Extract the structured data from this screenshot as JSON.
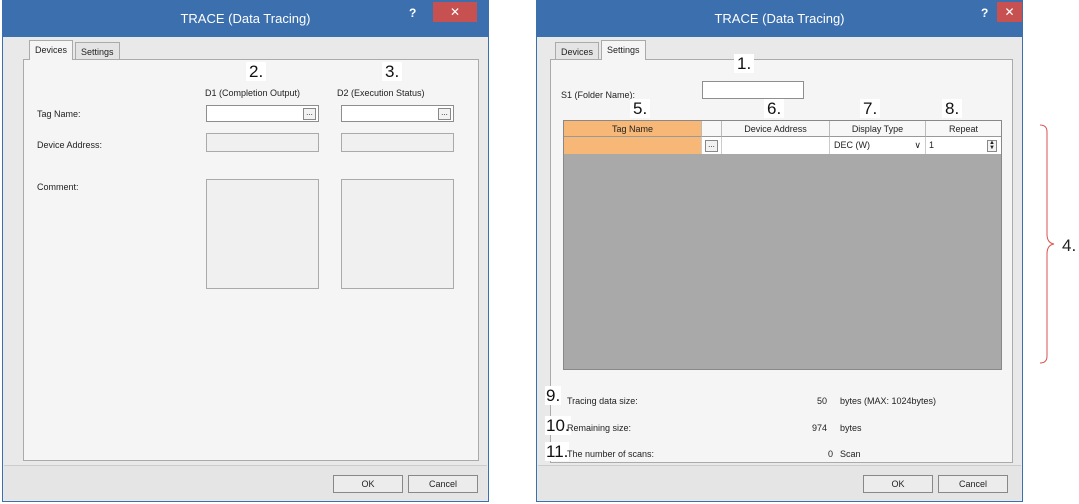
{
  "left_dialog": {
    "title": "TRACE (Data Tracing)",
    "help": "?",
    "close": "✕",
    "tabs": [
      "Devices",
      "Settings"
    ],
    "col_headers": [
      "D1 (Completion Output)",
      "D2 (Execution Status)"
    ],
    "row_labels": [
      "Tag Name:",
      "Device Address:",
      "Comment:"
    ],
    "callouts": [
      "2.",
      "3."
    ],
    "browse": "...",
    "ok": "OK",
    "cancel": "Cancel"
  },
  "right_dialog": {
    "title": "TRACE (Data Tracing)",
    "help": "?",
    "close": "✕",
    "tabs": [
      "Devices",
      "Settings"
    ],
    "folder_label": "S1 (Folder Name):",
    "table_headers": [
      "Tag Name",
      "Device Address",
      "Display Type",
      "Repeat"
    ],
    "row": {
      "browse": "...",
      "display_type": "DEC (W)",
      "repeat": "1"
    },
    "callouts": [
      "1.",
      "5.",
      "6.",
      "7.",
      "8.",
      "9.",
      "10.",
      "11."
    ],
    "side_callout": "4.",
    "stats": [
      {
        "label": "Tracing data size:",
        "value": "50",
        "unit": "bytes (MAX: 1024bytes)"
      },
      {
        "label": "Remaining size:",
        "value": "974",
        "unit": "bytes"
      },
      {
        "label": "The number of scans:",
        "value": "0",
        "unit": "Scan"
      }
    ],
    "ok": "OK",
    "cancel": "Cancel"
  },
  "colors": {
    "titlebar": "#3b6fae",
    "close": "#c75050",
    "selected_cell": "#f6b777",
    "grid_area": "#a9a9a9",
    "bracket": "#d9534f"
  }
}
